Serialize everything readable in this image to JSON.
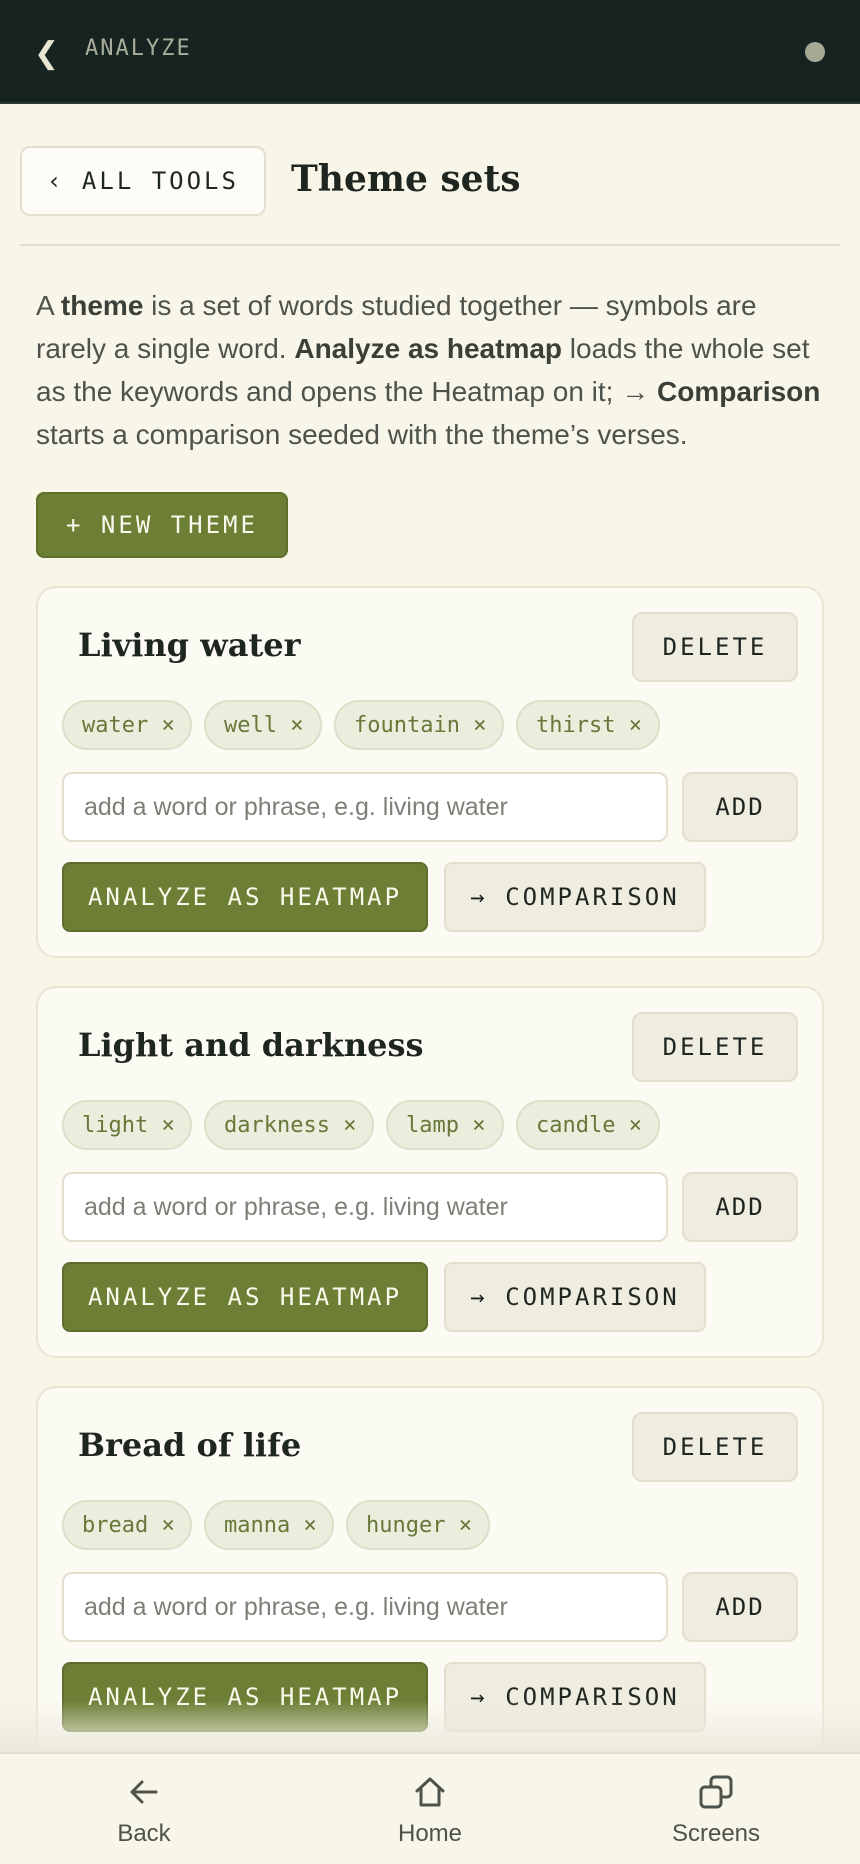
{
  "topbar": {
    "title": "ANALYZE"
  },
  "header": {
    "all_tools": "‹ ALL TOOLS",
    "title": "Theme sets"
  },
  "intro": {
    "p1": "A ",
    "b1": "theme",
    "p2": " is a set of words studied together — symbols are rarely a single word. ",
    "b2": "Analyze as heatmap",
    "p3": " loads the whole set as the keywords and opens the Heatmap on it; → ",
    "b3": "Comparison",
    "p4": " starts a comparison seeded with the theme’s verses."
  },
  "new_theme_label": "+ NEW THEME",
  "themes": [
    {
      "name": "Living water",
      "words": [
        "water ×",
        "well ×",
        "fountain ×",
        "thirst ×"
      ]
    },
    {
      "name": "Light and darkness",
      "words": [
        "light ×",
        "darkness ×",
        "lamp ×",
        "candle ×"
      ]
    },
    {
      "name": "Bread of life",
      "words": [
        "bread ×",
        "manna ×",
        "hunger ×"
      ]
    }
  ],
  "card_labels": {
    "delete": "DELETE",
    "placeholder": "add a word or phrase, e.g. living water",
    "add": "ADD",
    "analyze": "ANALYZE AS HEATMAP",
    "comparison": "→ COMPARISON"
  },
  "bottom_nav": {
    "back": "Back",
    "home": "Home",
    "screens": "Screens"
  },
  "colors": {
    "accent": "#6c7f35",
    "topbar": "#172320",
    "background": "#f8f5e9"
  }
}
